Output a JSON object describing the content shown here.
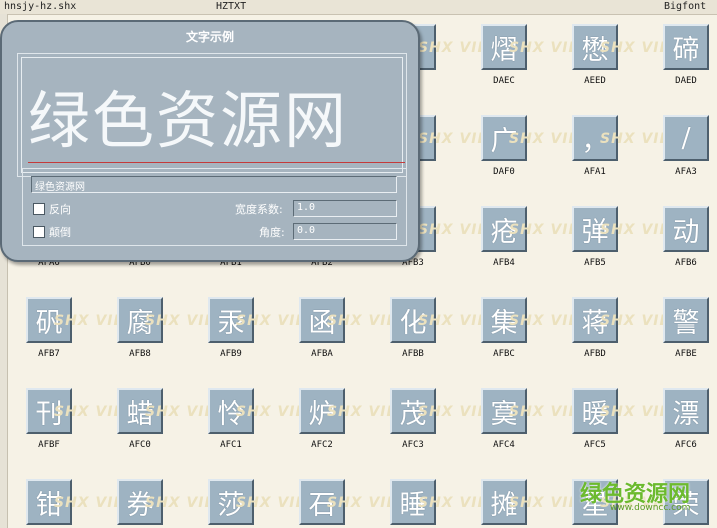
{
  "topbar": {
    "left": "hnsjy-hz.shx",
    "center": "HZTXT",
    "right": "Bigfont"
  },
  "watermark": "SHX VIEWER",
  "tiles": [
    {
      "char": "",
      "code": "",
      "row": 0,
      "col": 0
    },
    {
      "char": "",
      "code": "",
      "row": 0,
      "col": 1
    },
    {
      "char": "",
      "code": "",
      "row": 0,
      "col": 2
    },
    {
      "char": "",
      "code": "",
      "row": 0,
      "col": 3
    },
    {
      "char": "",
      "code": "",
      "row": 0,
      "col": 4
    },
    {
      "char": "熠",
      "code": "DAEC",
      "row": 0,
      "col": 5
    },
    {
      "char": "懋",
      "code": "AEED",
      "row": 0,
      "col": 6
    },
    {
      "char": "碲",
      "code": "DAED",
      "row": 0,
      "col": 7
    },
    {
      "char": "",
      "code": "",
      "row": 1,
      "col": 4
    },
    {
      "char": "广",
      "code": "DAF0",
      "row": 1,
      "col": 5
    },
    {
      "char": "，",
      "code": "AFA1",
      "row": 1,
      "col": 6
    },
    {
      "char": "/",
      "code": "AFA3",
      "row": 1,
      "col": 7
    },
    {
      "char": "",
      "code": "AFA6",
      "row": 2,
      "col": 0
    },
    {
      "char": "",
      "code": "AFB0",
      "row": 2,
      "col": 1
    },
    {
      "char": "",
      "code": "AFB1",
      "row": 2,
      "col": 2
    },
    {
      "char": "",
      "code": "AFB2",
      "row": 2,
      "col": 3
    },
    {
      "char": "",
      "code": "AFB3",
      "row": 2,
      "col": 4
    },
    {
      "char": "疮",
      "code": "AFB4",
      "row": 2,
      "col": 5
    },
    {
      "char": "弹",
      "code": "AFB5",
      "row": 2,
      "col": 6
    },
    {
      "char": "动",
      "code": "AFB6",
      "row": 2,
      "col": 7
    },
    {
      "char": "矾",
      "code": "AFB7",
      "row": 3,
      "col": 0
    },
    {
      "char": "腐",
      "code": "AFB8",
      "row": 3,
      "col": 1
    },
    {
      "char": "汞",
      "code": "AFB9",
      "row": 3,
      "col": 2
    },
    {
      "char": "函",
      "code": "AFBA",
      "row": 3,
      "col": 3
    },
    {
      "char": "化",
      "code": "AFBB",
      "row": 3,
      "col": 4
    },
    {
      "char": "集",
      "code": "AFBC",
      "row": 3,
      "col": 5
    },
    {
      "char": "蒋",
      "code": "AFBD",
      "row": 3,
      "col": 6
    },
    {
      "char": "警",
      "code": "AFBE",
      "row": 3,
      "col": 7
    },
    {
      "char": "刊",
      "code": "AFBF",
      "row": 4,
      "col": 0
    },
    {
      "char": "蜡",
      "code": "AFC0",
      "row": 4,
      "col": 1
    },
    {
      "char": "怜",
      "code": "AFC1",
      "row": 4,
      "col": 2
    },
    {
      "char": "炉",
      "code": "AFC2",
      "row": 4,
      "col": 3
    },
    {
      "char": "茂",
      "code": "AFC3",
      "row": 4,
      "col": 4
    },
    {
      "char": "寞",
      "code": "AFC4",
      "row": 4,
      "col": 5
    },
    {
      "char": "暖",
      "code": "AFC5",
      "row": 4,
      "col": 6
    },
    {
      "char": "漂",
      "code": "AFC6",
      "row": 4,
      "col": 7
    },
    {
      "char": "钳",
      "code": "",
      "row": 5,
      "col": 0
    },
    {
      "char": "券",
      "code": "",
      "row": 5,
      "col": 1
    },
    {
      "char": "莎",
      "code": "",
      "row": 5,
      "col": 2
    },
    {
      "char": "石",
      "code": "",
      "row": 5,
      "col": 3
    },
    {
      "char": "睡",
      "code": "",
      "row": 5,
      "col": 4
    },
    {
      "char": "摊",
      "code": "",
      "row": 5,
      "col": 5
    },
    {
      "char": "星",
      "code": "",
      "row": 5,
      "col": 6
    },
    {
      "char": "荣",
      "code": "",
      "row": 5,
      "col": 7
    }
  ],
  "dialog": {
    "title": "文字示例",
    "preview_text": "绿色资源网",
    "text_value": "绿色资源网",
    "reverse_label": "反向",
    "upside_down_label": "颠倒",
    "width_factor_label": "宽度系数:",
    "width_factor_value": "1.0",
    "angle_label": "角度:",
    "angle_value": "0.0"
  },
  "brand": {
    "name": "绿色资源网",
    "url": "www.downcc.com"
  },
  "colors": {
    "tile": "#9eb3c2",
    "background": "#f6f2e6",
    "dialog": "#a6b4bf",
    "baseline": "#c43a3a",
    "brand": "#6cba2e"
  }
}
